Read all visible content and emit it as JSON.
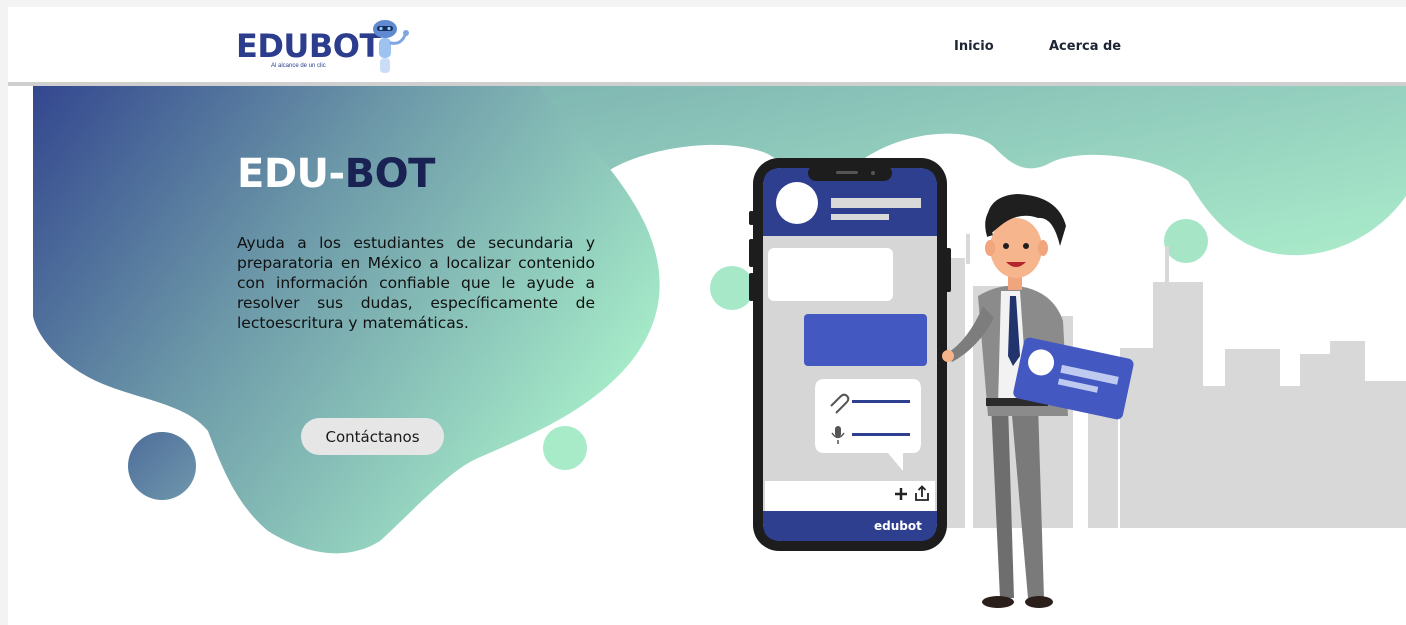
{
  "brand": {
    "name": "EDUBOT",
    "tagline": "Al alcance de un clic"
  },
  "nav": {
    "items": [
      {
        "label": "Inicio"
      },
      {
        "label": "Acerca de"
      }
    ]
  },
  "hero": {
    "title_light": "EDU-",
    "title_dark": "BOT",
    "description": "Ayuda a los estudiantes de secundaria y preparatoria en México a localizar contenido con información confiable que le ayude a resolver sus dudas, específicamente de lectoescritura y matemáticas.",
    "cta_label": "Contáctanos"
  },
  "phone": {
    "brand_label": "edubot",
    "icons": [
      "attachment-icon",
      "microphone-icon",
      "plus-icon",
      "share-icon"
    ]
  },
  "colors": {
    "navy": "#2c3d8d",
    "teal": "#6e9aa8",
    "mint": "#a8e8c8",
    "button": "#e6e6e6",
    "skyline": "#d8d8d8"
  }
}
